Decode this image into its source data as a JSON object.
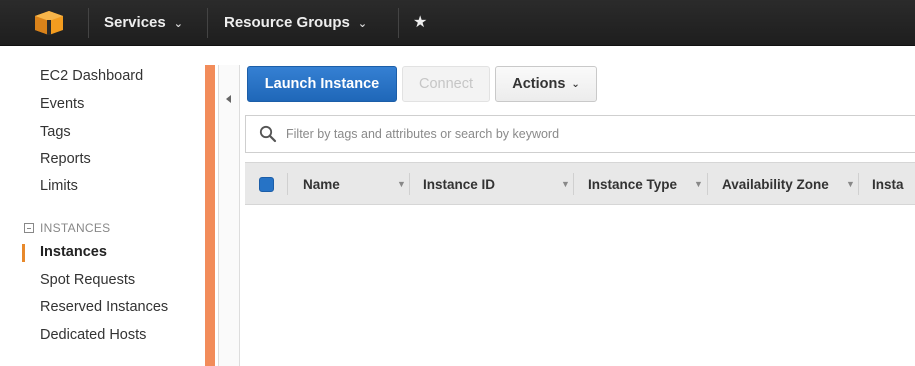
{
  "topnav": {
    "services": "Services",
    "resource_groups": "Resource Groups",
    "caret": "⌄",
    "pin": "★"
  },
  "sidebar": {
    "items_top": [
      "EC2 Dashboard",
      "Events",
      "Tags",
      "Reports",
      "Limits"
    ],
    "section_title": "INSTANCES",
    "items_instances": [
      "Instances",
      "Spot Requests",
      "Reserved Instances",
      "Dedicated Hosts"
    ],
    "active_item": "Instances"
  },
  "toolbar": {
    "launch_label": "Launch Instance",
    "connect_label": "Connect",
    "actions_label": "Actions",
    "actions_caret": "⌄"
  },
  "filter": {
    "placeholder": "Filter by tags and attributes or search by keyword"
  },
  "table": {
    "columns": [
      "Name",
      "Instance ID",
      "Instance Type",
      "Availability Zone",
      "Insta"
    ],
    "sort_glyph": "▼"
  },
  "colors": {
    "accent_blue": "#2673c6",
    "orange_strip": "#f28c5a",
    "active_marker": "#e8892b",
    "topbar": "#232323"
  },
  "icons": {
    "logo": "aws-cube-logo",
    "search": "search-icon",
    "pin": "pin-star-icon",
    "collapse": "collapse-panel-icon"
  }
}
